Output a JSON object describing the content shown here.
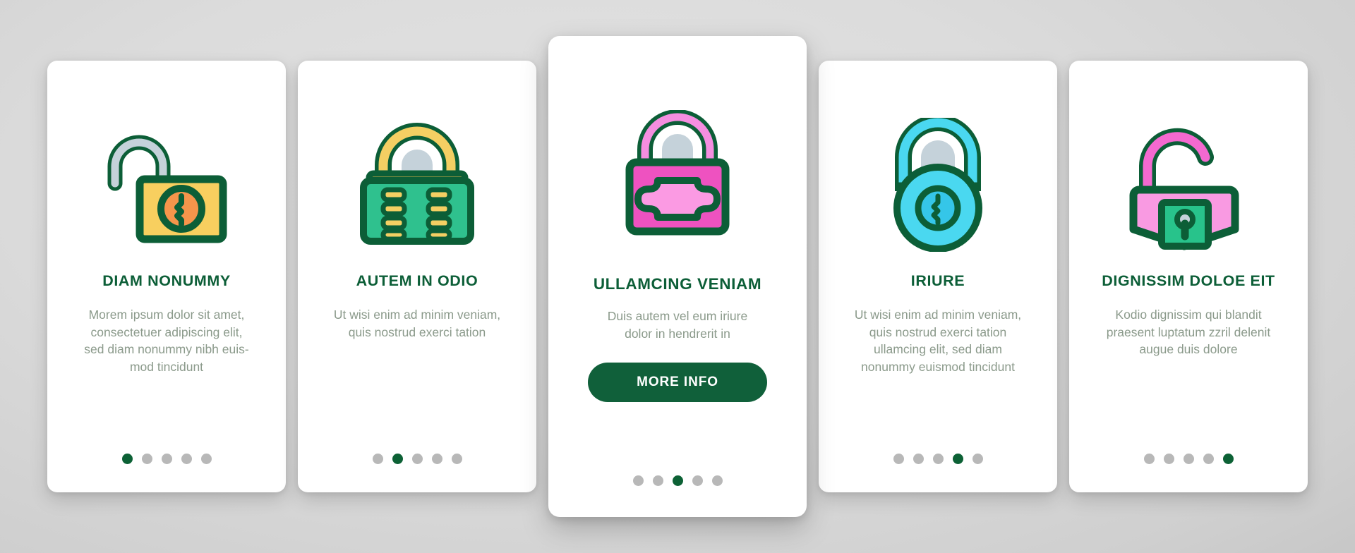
{
  "theme": {
    "accent_green": "#0c5e37",
    "button_green": "#10603a",
    "body_text": "#8b9a8b",
    "dot_inactive": "#b8b8b8",
    "dot_active": "#0c6135",
    "card_bg": "#ffffff",
    "page_bg": "#cfcfcf"
  },
  "carousel": {
    "total_slides": 5,
    "cards": [
      {
        "icon_name": "open-padlock-yellow-icon",
        "title": "DIAM NONUMMY",
        "body": "Morem ipsum dolor sit amet, consectetuer adipiscing elit, sed diam nonummy nibh euis-mod tincidunt",
        "active_dot": 1,
        "featured": false,
        "cta_label": ""
      },
      {
        "icon_name": "combination-padlock-green-icon",
        "title": "AUTEM IN ODIO",
        "body": "Ut wisi enim ad minim veniam, quis nostrud exerci tation",
        "active_dot": 2,
        "featured": false,
        "cta_label": ""
      },
      {
        "icon_name": "closed-padlock-pink-icon",
        "title": "ULLAMCING VENIAM",
        "body": "Duis autem vel eum iriure dolor in hendrerit in",
        "active_dot": 3,
        "featured": true,
        "cta_label": "MORE INFO"
      },
      {
        "icon_name": "round-combination-lock-cyan-icon",
        "title": "IRIURE",
        "body": "Ut wisi enim ad minim veniam, quis nostrud exerci tation ullamcing elit, sed diam nonummy euismod tincidunt",
        "active_dot": 4,
        "featured": false,
        "cta_label": ""
      },
      {
        "icon_name": "unlocked-padlock-pink-icon",
        "title": "DIGNISSIM DOLOE EIT",
        "body": "Kodio dignissim qui blandit praesent luptatum zzril delenit augue duis dolore",
        "active_dot": 5,
        "featured": false,
        "cta_label": ""
      }
    ]
  }
}
